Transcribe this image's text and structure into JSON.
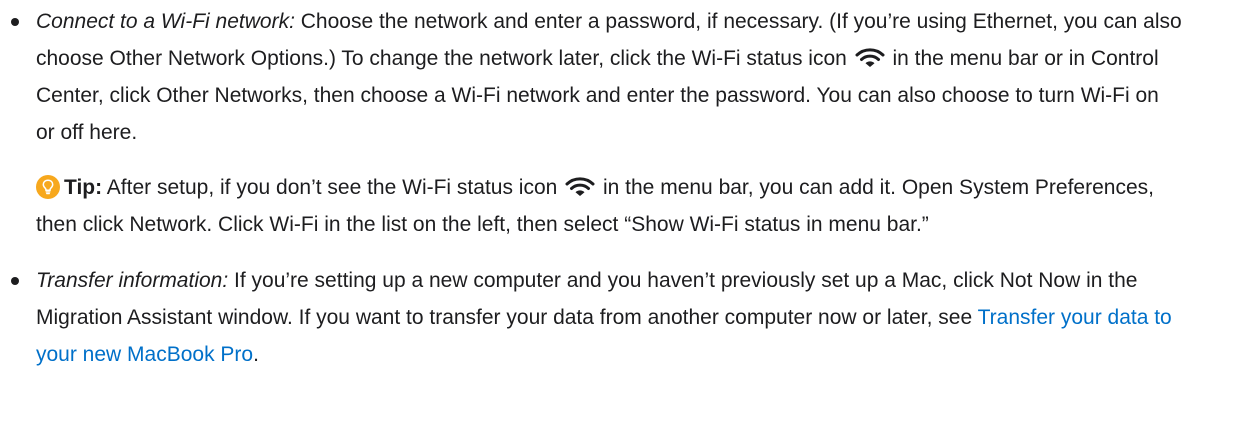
{
  "items": [
    {
      "lead": "Connect to a Wi-Fi network:",
      "text1": " Choose the network and enter a password, if necessary. (If you’re using Ethernet, you can also choose Other Network Options.) To change the network later, click the Wi-Fi status icon ",
      "icon": "wifi-icon",
      "text2": " in the menu bar or in Control Center, click Other Networks, then choose a Wi-Fi network and enter the password. You can also choose to turn Wi-Fi on or off here."
    },
    {
      "lead": "Transfer information:",
      "text1": " If you’re setting up a new computer and you haven’t previously set up a Mac, click Not Now in the Migration Assistant window. If you want to transfer your data from another computer now or later, see ",
      "link": "Transfer your data to your new MacBook Pro",
      "text2": "."
    }
  ],
  "tip": {
    "icon": "lightbulb-icon",
    "label": "Tip:",
    "text1": " After setup, if you don’t see the Wi-Fi status icon ",
    "wifi_icon": "wifi-icon",
    "text2": " in the menu bar, you can add it. Open System Preferences, then click Network. Click Wi-Fi in the list on the left, then select “Show Wi-Fi status in menu bar.”"
  },
  "colors": {
    "text": "#1d1d1f",
    "link": "#0070c9",
    "tip_icon": "#f7a81d"
  }
}
